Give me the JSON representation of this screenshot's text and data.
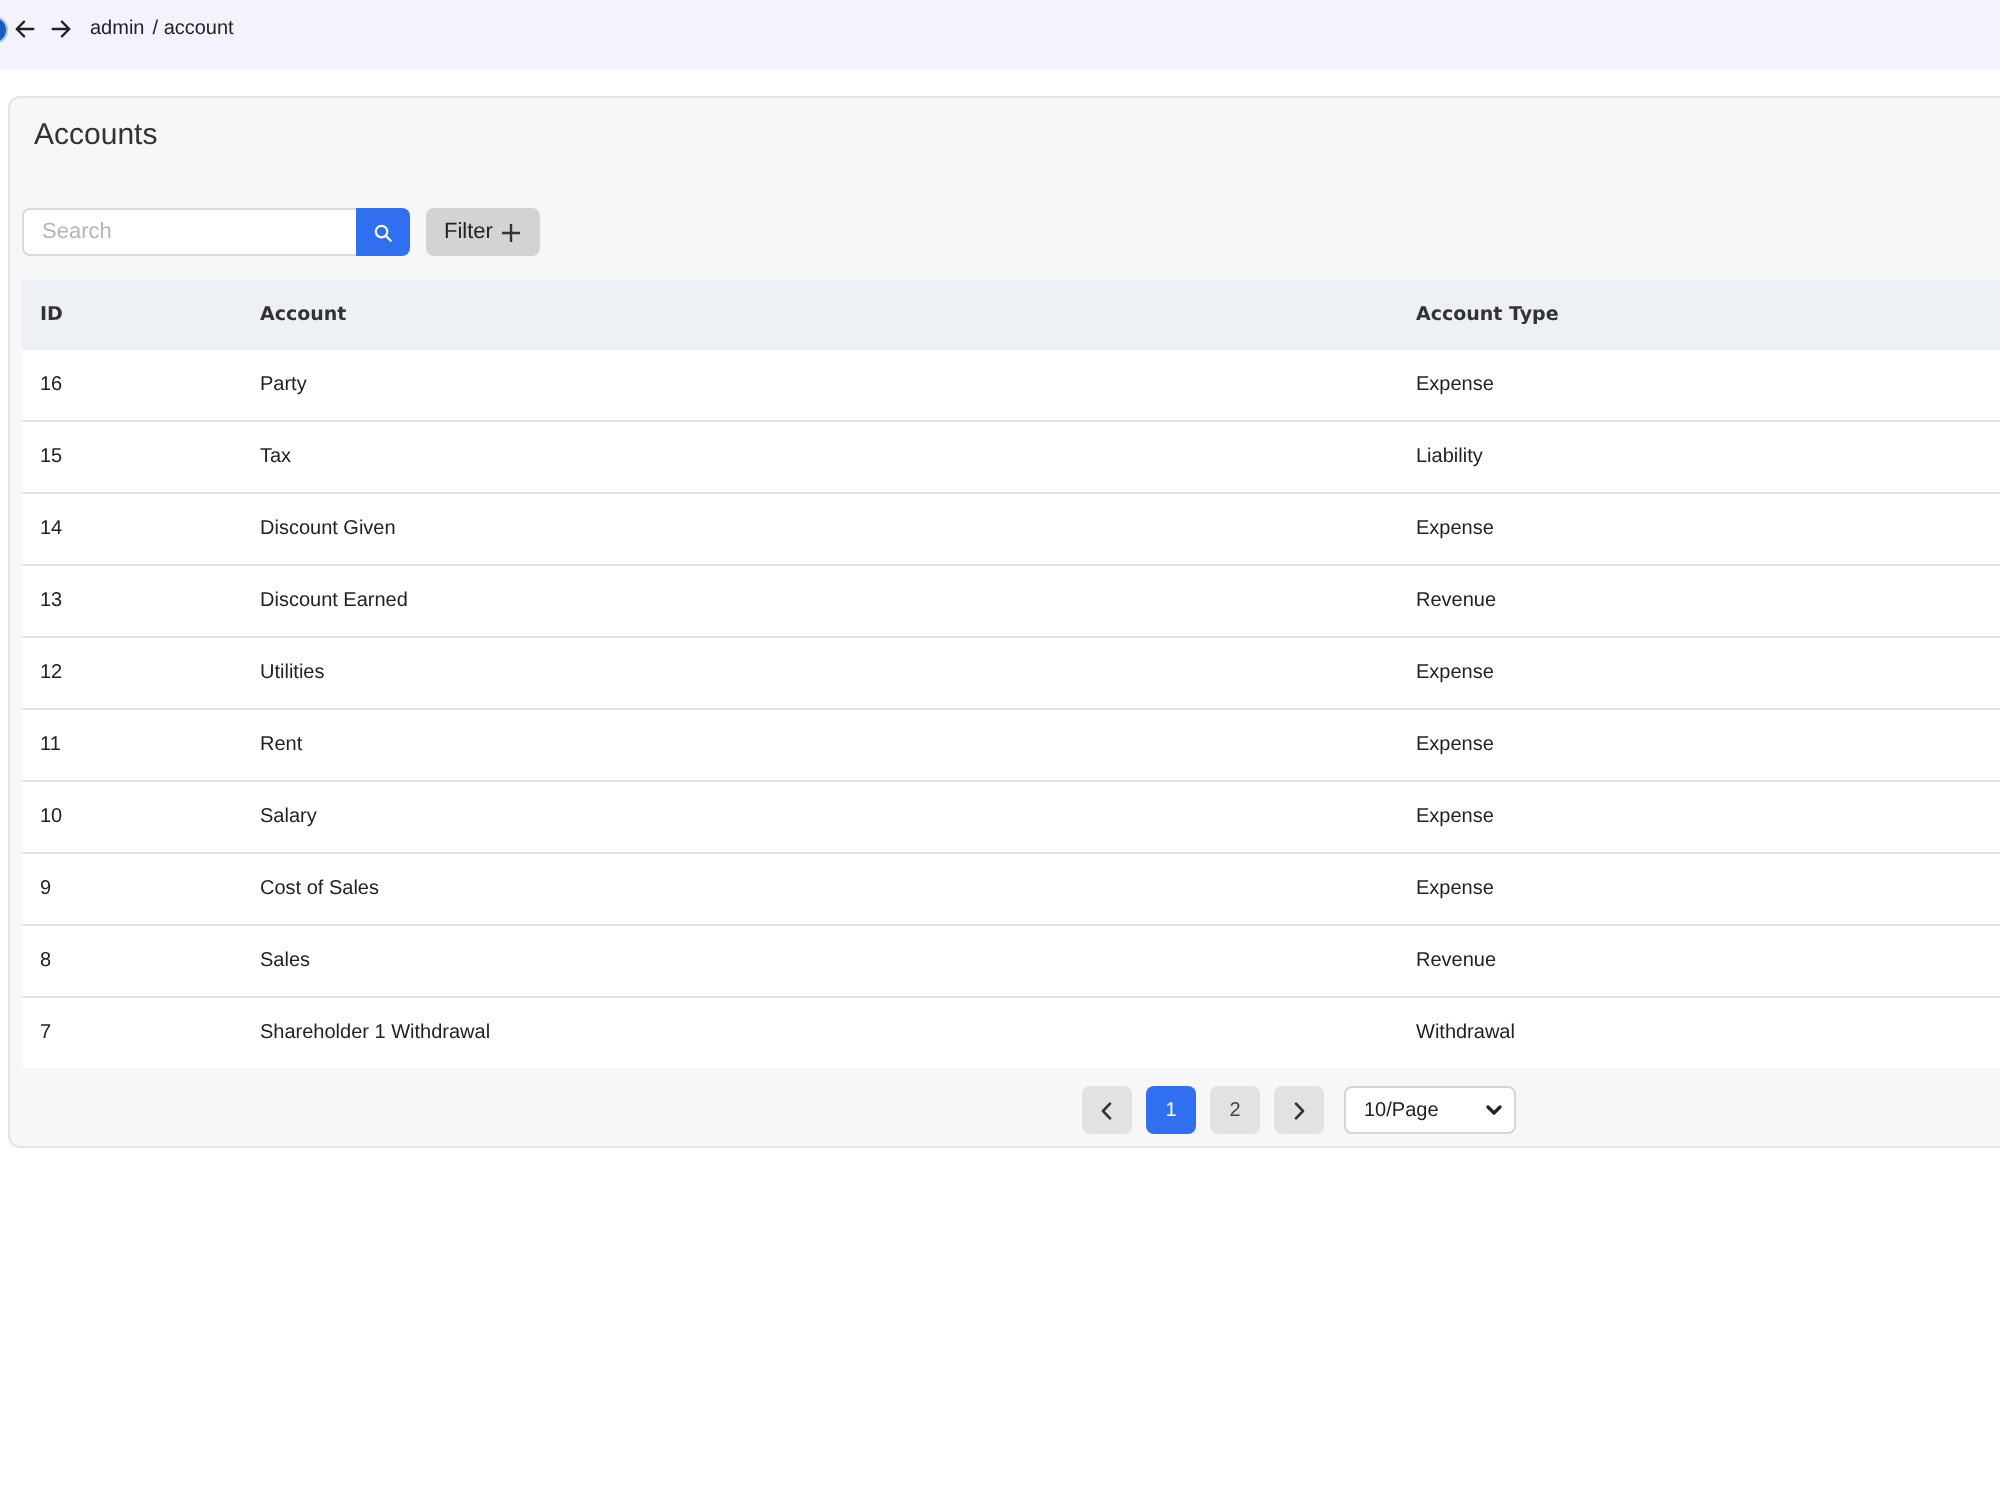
{
  "topbar": {
    "breadcrumb": [
      {
        "label": "admin"
      },
      {
        "label": "account"
      }
    ],
    "separator": "/"
  },
  "card": {
    "title": "Accounts"
  },
  "search": {
    "placeholder": "Search"
  },
  "filter_button": {
    "label": "Filter"
  },
  "table": {
    "columns": [
      "ID",
      "Account",
      "Account Type"
    ],
    "rows": [
      [
        "16",
        "Party",
        "Expense"
      ],
      [
        "15",
        "Tax",
        "Liability"
      ],
      [
        "14",
        "Discount Given",
        "Expense"
      ],
      [
        "13",
        "Discount Earned",
        "Revenue"
      ],
      [
        "12",
        "Utilities",
        "Expense"
      ],
      [
        "11",
        "Rent",
        "Expense"
      ],
      [
        "10",
        "Salary",
        "Expense"
      ],
      [
        "9",
        "Cost of Sales",
        "Expense"
      ],
      [
        "8",
        "Sales",
        "Revenue"
      ],
      [
        "7",
        "Shareholder 1 Withdrawal",
        "Withdrawal"
      ]
    ]
  },
  "pagination": {
    "pages": [
      {
        "label": "1",
        "selected": true
      },
      {
        "label": "2",
        "selected": false
      }
    ],
    "page_size": "10/Page"
  }
}
